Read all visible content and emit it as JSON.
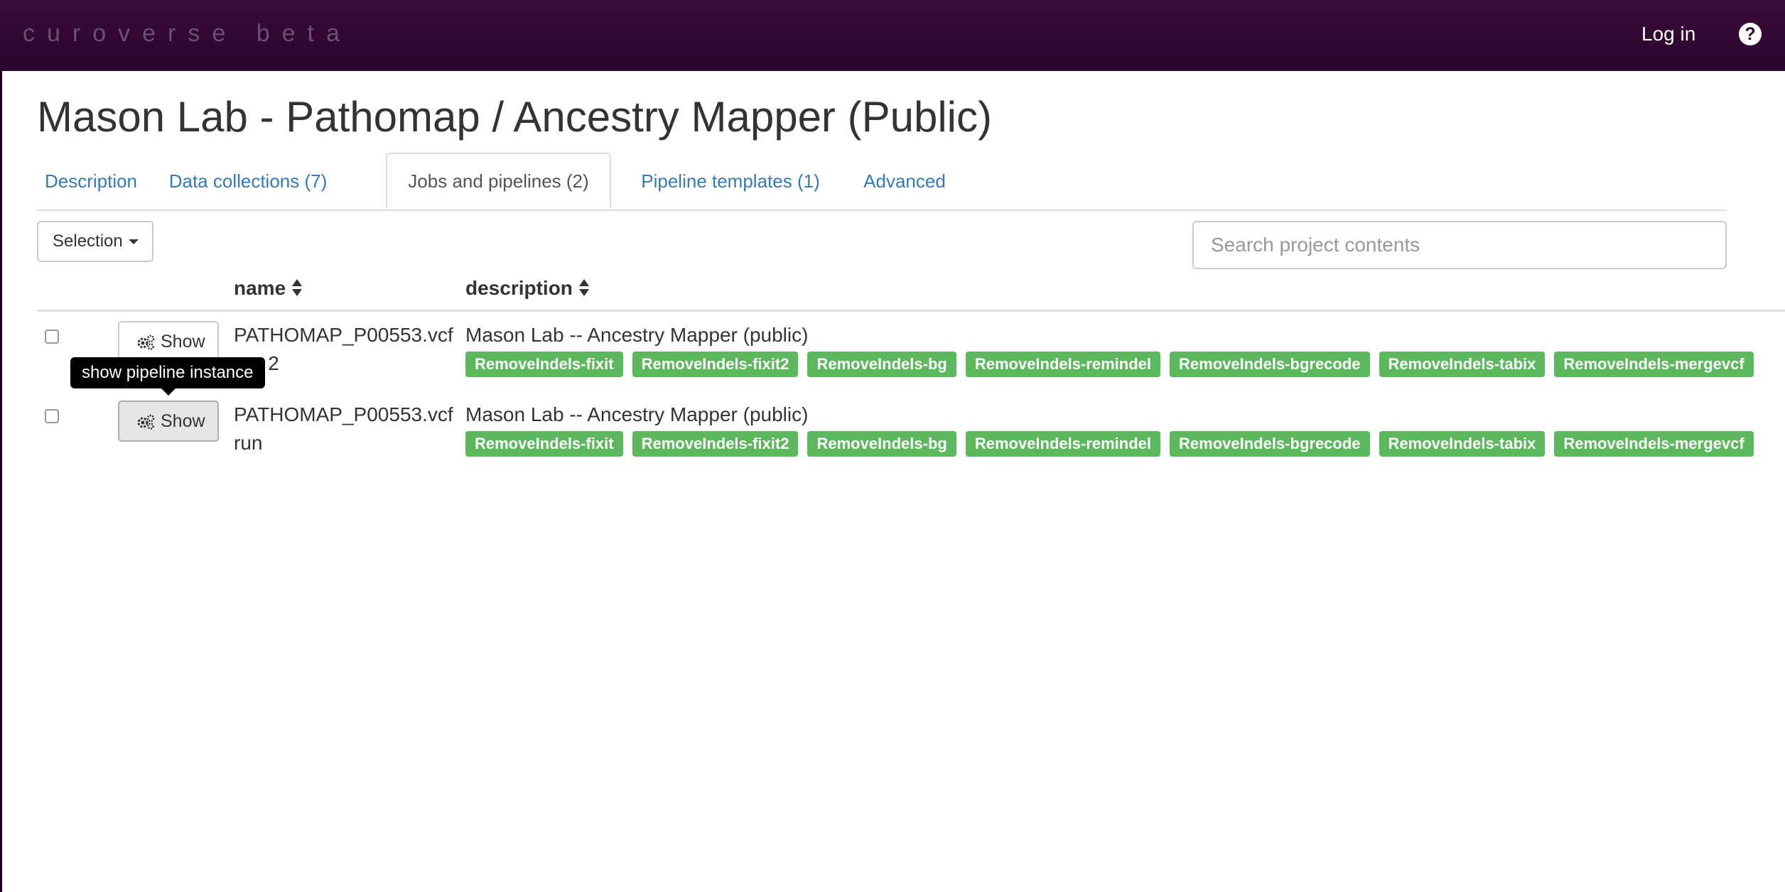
{
  "navbar": {
    "brand": "curoverse beta",
    "login_label": "Log in",
    "help_icon": "question-circle-icon",
    "background_color": "#2d0730"
  },
  "page": {
    "title": "Mason Lab - Pathomap / Ancestry Mapper (Public)"
  },
  "tabs": [
    {
      "label": "Description",
      "active": false
    },
    {
      "label": "Data collections (7)",
      "active": false
    },
    {
      "label": "Jobs and pipelines (2)",
      "active": true
    },
    {
      "label": "Pipeline templates (1)",
      "active": false
    },
    {
      "label": "Advanced",
      "active": false
    }
  ],
  "toolbar": {
    "selection_label": "Selection",
    "search_placeholder": "Search project contents"
  },
  "table": {
    "columns": [
      {
        "label": "name",
        "sortable": true
      },
      {
        "label": "description",
        "sortable": true
      }
    ],
    "rows": [
      {
        "show_label": "Show",
        "name_line1": "PATHOMAP_P00553.vcf",
        "name_line2": "run 2",
        "description": "Mason Lab -- Ancestry Mapper (public)",
        "tags": [
          "RemoveIndels-fixit",
          "RemoveIndels-fixit2",
          "RemoveIndels-bg",
          "RemoveIndels-remindel",
          "RemoveIndels-bgrecode",
          "RemoveIndels-tabix",
          "RemoveIndels-mergevcf"
        ]
      },
      {
        "show_label": "Show",
        "name_line1": "PATHOMAP_P00553.vcf",
        "name_line2": "run",
        "description": "Mason Lab -- Ancestry Mapper (public)",
        "tags": [
          "RemoveIndels-fixit",
          "RemoveIndels-fixit2",
          "RemoveIndels-bg",
          "RemoveIndels-remindel",
          "RemoveIndels-bgrecode",
          "RemoveIndels-tabix",
          "RemoveIndels-mergevcf"
        ]
      }
    ]
  },
  "tooltip": {
    "text": "show pipeline instance"
  },
  "colors": {
    "tag_green": "#5cb85c",
    "link_blue": "#337ab7"
  }
}
